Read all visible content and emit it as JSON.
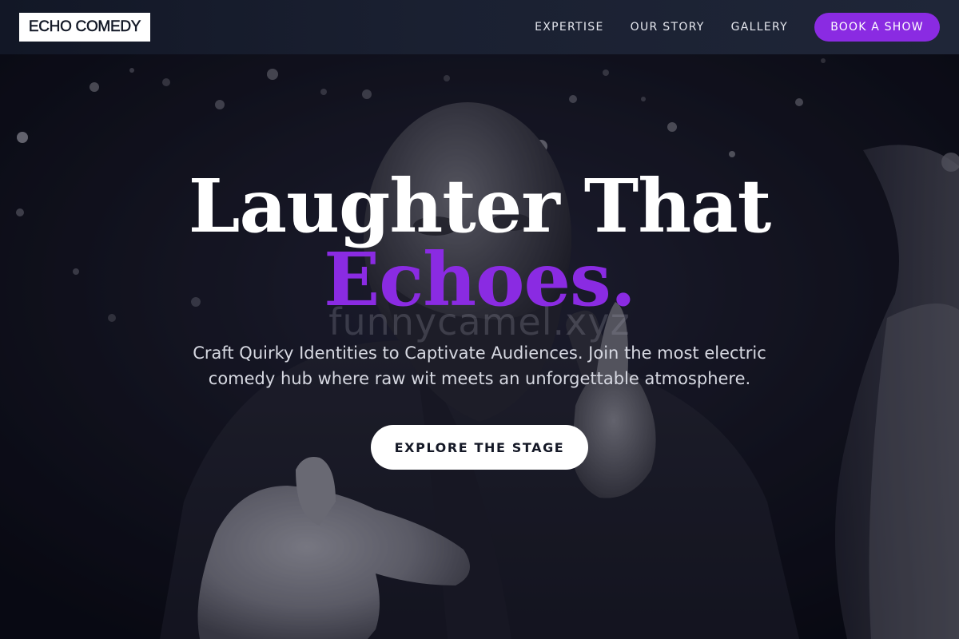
{
  "brand": {
    "logo_text": "ECHO COMEDY"
  },
  "nav": {
    "links": [
      {
        "label": "EXPERTISE"
      },
      {
        "label": "OUR STORY"
      },
      {
        "label": "GALLERY"
      }
    ],
    "cta_label": "BOOK A SHOW"
  },
  "hero": {
    "headline_line1": "Laughter That",
    "headline_line2": "Echoes.",
    "watermark": "funnycamel.xyz",
    "subtitle": "Craft Quirky Identities to Captivate Audiences. Join the most electric comedy hub where raw wit meets an unforgettable atmosphere.",
    "cta_label": "EXPLORE THE STAGE",
    "background_image": "comedian-pointing-photo"
  },
  "colors": {
    "accent": "#8a2be2",
    "navbar_bg": "#1a2031",
    "hero_text": "#ffffff",
    "subtitle_text": "#d7d9e2"
  }
}
